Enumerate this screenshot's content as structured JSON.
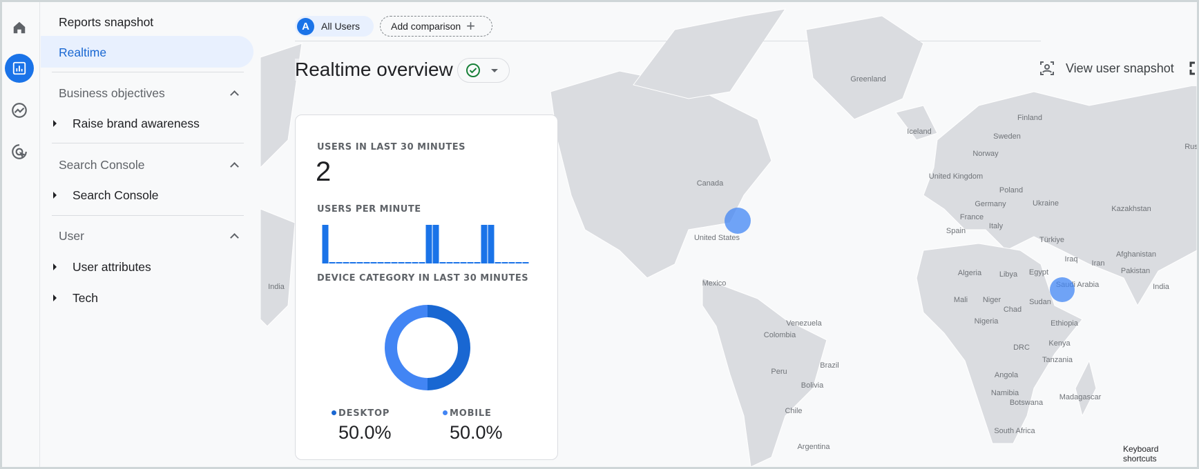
{
  "rail": {
    "items": [
      {
        "icon": "home-icon"
      },
      {
        "icon": "reports-icon",
        "active": true
      },
      {
        "icon": "explore-icon"
      },
      {
        "icon": "advertising-icon"
      }
    ]
  },
  "sidebar": {
    "reports_snapshot": "Reports snapshot",
    "realtime": "Realtime",
    "sections": [
      {
        "title": "Business objectives",
        "items": [
          "Raise brand awareness"
        ]
      },
      {
        "title": "Search Console",
        "items": [
          "Search Console"
        ]
      },
      {
        "title": "User",
        "items": [
          "User attributes",
          "Tech"
        ]
      }
    ]
  },
  "header": {
    "segment_badge": "A",
    "segment": "All Users",
    "add_comparison": "Add comparison",
    "title": "Realtime overview",
    "view_user_snapshot": "View user snapshot"
  },
  "card": {
    "users_label": "USERS IN LAST 30 MINUTES",
    "users_value": "2",
    "per_minute_label": "USERS PER MINUTE",
    "users_per_minute": [
      1,
      0,
      0,
      0,
      0,
      0,
      0,
      0,
      0,
      0,
      0,
      0,
      0,
      0,
      0,
      1,
      1,
      0,
      0,
      0,
      0,
      0,
      0,
      1,
      1,
      0,
      0,
      0,
      0,
      0
    ],
    "device_label": "DEVICE CATEGORY IN LAST 30 MINUTES",
    "devices": [
      {
        "name": "DESKTOP",
        "pct": "50.0%",
        "value": 50,
        "color": "#1967d2"
      },
      {
        "name": "MOBILE",
        "pct": "50.0%",
        "value": 50,
        "color": "#4285f4"
      }
    ]
  },
  "map": {
    "labels": [
      "Greenland",
      "Iceland",
      "Finland",
      "Sweden",
      "Norway",
      "United Kingdom",
      "Poland",
      "Germany",
      "Ukraine",
      "Kazakhstan",
      "France",
      "Spain",
      "Italy",
      "Türkiye",
      "Iraq",
      "Iran",
      "Afghanistan",
      "Pakistan",
      "India",
      "Algeria",
      "Libya",
      "Egypt",
      "Saudi Arabia",
      "Mali",
      "Niger",
      "Sudan",
      "Chad",
      "Nigeria",
      "Ethiopia",
      "Kenya",
      "Tanzania",
      "DRC",
      "Angola",
      "Namibia",
      "Botswana",
      "Madagascar",
      "South Africa",
      "Canada",
      "United States",
      "Mexico",
      "Venezuela",
      "Colombia",
      "Brazil",
      "Peru",
      "Bolivia",
      "Chile",
      "Argentina",
      "India",
      "Rus"
    ],
    "keyboard_shortcuts": "Keyboard shortcuts"
  },
  "colors": {
    "accent": "#1a73e8",
    "bar": "#1a73e8",
    "land": "#dadce0",
    "ok": "#188038"
  }
}
